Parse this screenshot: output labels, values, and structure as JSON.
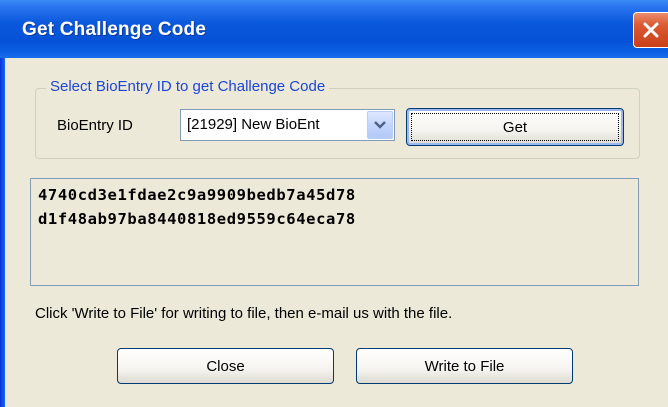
{
  "window": {
    "title": "Get Challenge Code",
    "close_icon": "close-x-icon"
  },
  "group": {
    "legend": "Select BioEntry ID to get Challenge Code",
    "field_label": "BioEntry ID",
    "select_value": "[21929] New BioEnt",
    "select_arrow_icon": "chevron-down-icon",
    "get_button_label": "Get"
  },
  "code": {
    "lines": [
      "4740cd3e1fdae2c9a9909bedb7a45d78",
      "d1f48ab97ba8440818ed9559c64eca78"
    ]
  },
  "instruction": "Click 'Write to File' for writing to file, then e-mail us with the file.",
  "buttons": {
    "close_label": "Close",
    "write_label": "Write to File"
  },
  "colors": {
    "titlebar": "#0652d6",
    "legend_text": "#1a46d9",
    "window_bg": "#ece9d8",
    "close_button": "#dc5a34"
  }
}
